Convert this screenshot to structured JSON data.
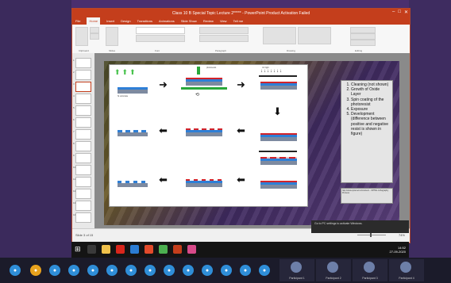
{
  "window": {
    "title": "Class 10 B Special Topic Lecture 2***** - PowerPoint Product Activation Failed"
  },
  "ribbon": {
    "tabs": [
      "File",
      "Home",
      "Insert",
      "Design",
      "Transitions",
      "Animations",
      "Slide Show",
      "Review",
      "View",
      "Tell me"
    ],
    "groups": [
      "Clipboard",
      "Slides",
      "Font",
      "Paragraph",
      "Drawing",
      "Editing"
    ]
  },
  "slide": {
    "steps": [
      "Cleaning (not shown)",
      "Growth of Oxide Layer",
      "Spin coating of the photoresist",
      "Exposure",
      "Development (difference between positive and negative resist is shown in figure)"
    ],
    "reference": "http://www.nptel.ac.in/courses/... NPTEL Lithography Process"
  },
  "statusbar": {
    "left": "Slide 3 of 15",
    "zoom": "74%"
  },
  "notification": {
    "text": "Go to PC settings to activate Windows."
  },
  "clock": {
    "time": "14:52",
    "date": "27-09-2020"
  },
  "meeting": {
    "participants": [
      "Participant 1",
      "Participant 2",
      "Participant 3",
      "Participant 4"
    ]
  },
  "colors": {
    "accent": "#c43e1c",
    "substrate": "#7d8aa0",
    "oxide": "#2e7fd6",
    "resist": "#d2232a",
    "uv": "#46c24a"
  }
}
